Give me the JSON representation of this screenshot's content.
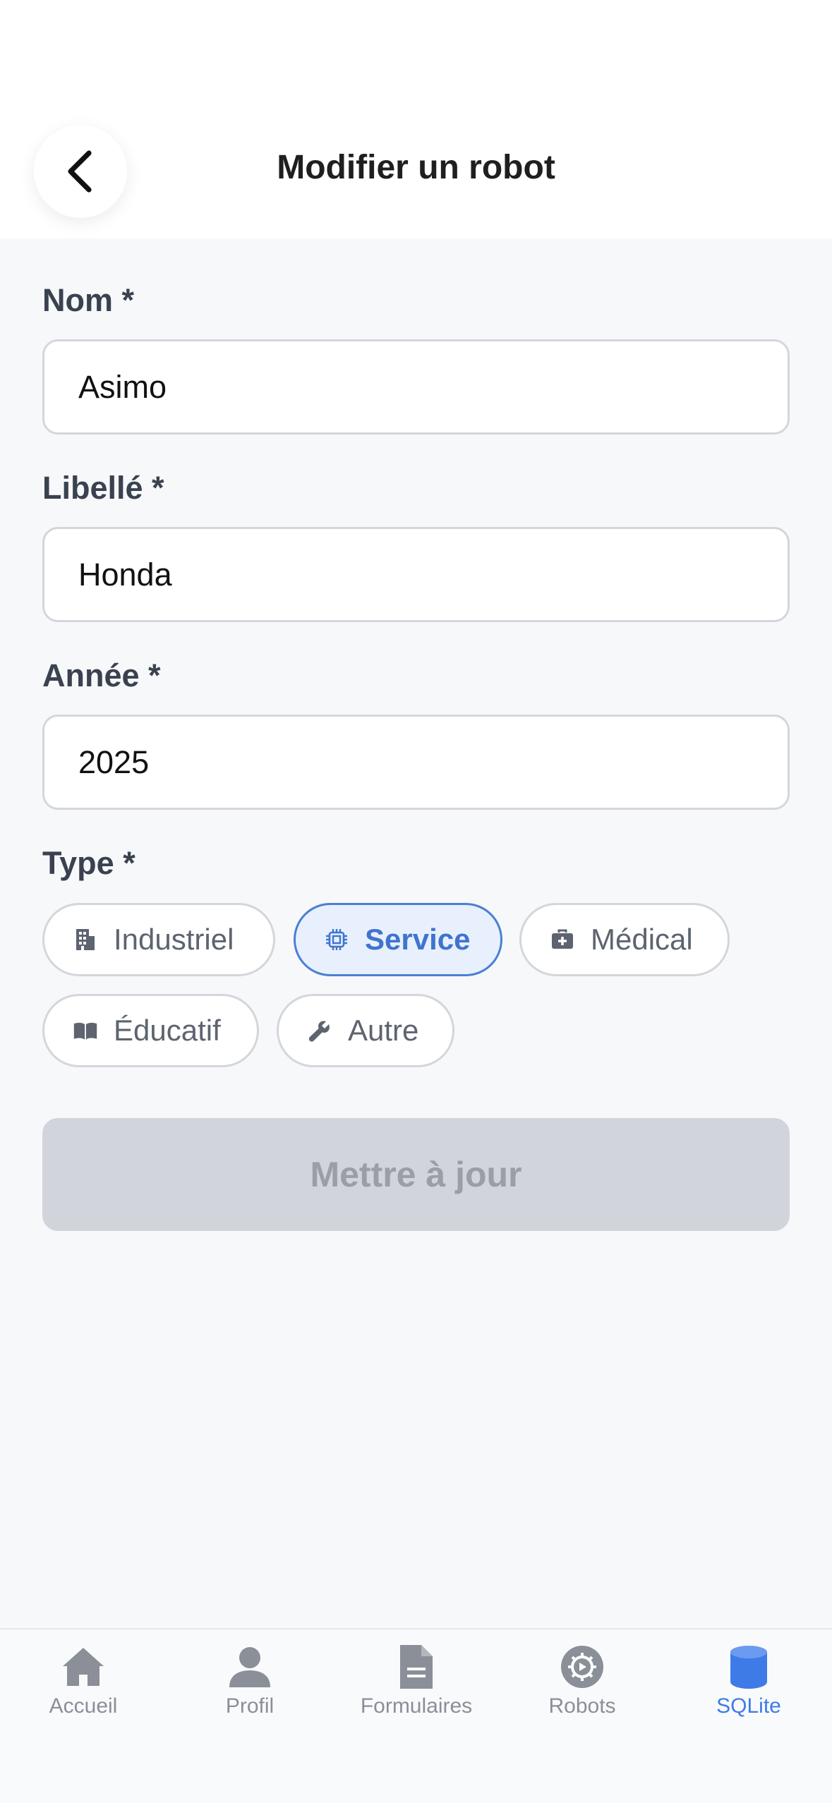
{
  "header": {
    "title": "Modifier un robot"
  },
  "form": {
    "name": {
      "label": "Nom *",
      "value": "Asimo"
    },
    "libelle": {
      "label": "Libellé *",
      "value": "Honda"
    },
    "year": {
      "label": "Année *",
      "value": "2025"
    },
    "type": {
      "label": "Type *",
      "options": [
        "Industriel",
        "Service",
        "Médical",
        "Éducatif",
        "Autre"
      ],
      "selected": "Service"
    },
    "submit_label": "Mettre à jour"
  },
  "tabs": [
    "Accueil",
    "Profil",
    "Formulaires",
    "Robots",
    "SQLite"
  ],
  "active_tab": "SQLite",
  "colors": {
    "accent": "#3f7be6",
    "selected_chip_border": "#4a7fd4",
    "disabled_button": "#d1d4da"
  },
  "icons": {
    "back": "chevron-left-icon",
    "industriel": "building-icon",
    "service": "chip-icon",
    "medical": "medkit-icon",
    "educatif": "book-icon",
    "autre": "wrench-icon",
    "accueil": "home-icon",
    "profil": "person-icon",
    "formulaires": "document-icon",
    "robots": "gear-circle-icon",
    "sqlite": "database-icon"
  }
}
